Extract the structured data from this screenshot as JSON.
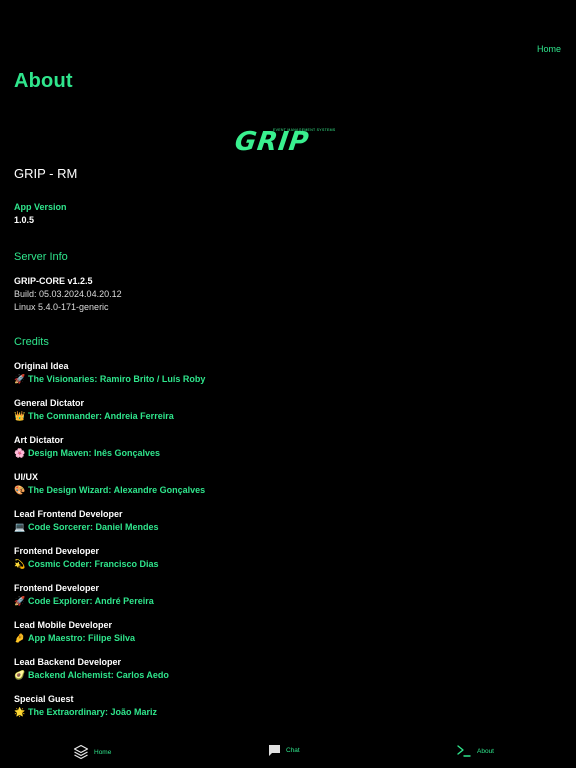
{
  "header": {
    "home_link": "Home",
    "title": "About"
  },
  "logo": {
    "text": "GRIP",
    "tagline": "EVENT MANAGEMENT SYSTEMS"
  },
  "app": {
    "name": "GRIP - RM",
    "version_label": "App Version",
    "version_value": "1.0.5"
  },
  "server": {
    "title": "Server Info",
    "name": "GRIP-CORE v1.2.5",
    "build": "Build: 05.03.2024.04.20.12",
    "os": "Linux  5.4.0-171-generic"
  },
  "credits": {
    "title": "Credits",
    "items": [
      {
        "role": "Original Idea",
        "emoji": "🚀",
        "name": "The Visionaries: Ramiro Brito / Luís Roby"
      },
      {
        "role": "General Dictator",
        "emoji": "👑",
        "name": "The Commander: Andreia Ferreira"
      },
      {
        "role": "Art Dictator",
        "emoji": "🌸",
        "name": "Design Maven: Inês Gonçalves"
      },
      {
        "role": "UI/UX",
        "emoji": "🎨",
        "name": "The Design Wizard: Alexandre Gonçalves"
      },
      {
        "role": "Lead Frontend Developer",
        "emoji": "💻",
        "name": "Code Sorcerer: Daniel Mendes"
      },
      {
        "role": "Frontend Developer",
        "emoji": "💫",
        "name": "Cosmic Coder: Francisco Dias"
      },
      {
        "role": "Frontend Developer",
        "emoji": "🚀",
        "name": "Code Explorer: André Pereira"
      },
      {
        "role": "Lead Mobile Developer",
        "emoji": "🤌",
        "name": "App Maestro: Filipe Silva"
      },
      {
        "role": "Lead Backend Developer",
        "emoji": "🥑",
        "name": "Backend Alchemist: Carlos Aedo"
      },
      {
        "role": "Special Guest",
        "emoji": "🌟",
        "name": "The Extraordinary: João Mariz"
      }
    ]
  },
  "tabbar": {
    "home": {
      "label": "Home",
      "icon": "layers-icon"
    },
    "chat": {
      "label": "Chat",
      "icon": "chat-bubble-icon"
    },
    "about": {
      "label": "About",
      "icon": "terminal-icon"
    }
  },
  "colors": {
    "accent": "#2fe58c",
    "background": "#000000",
    "text": "#ffffff"
  }
}
